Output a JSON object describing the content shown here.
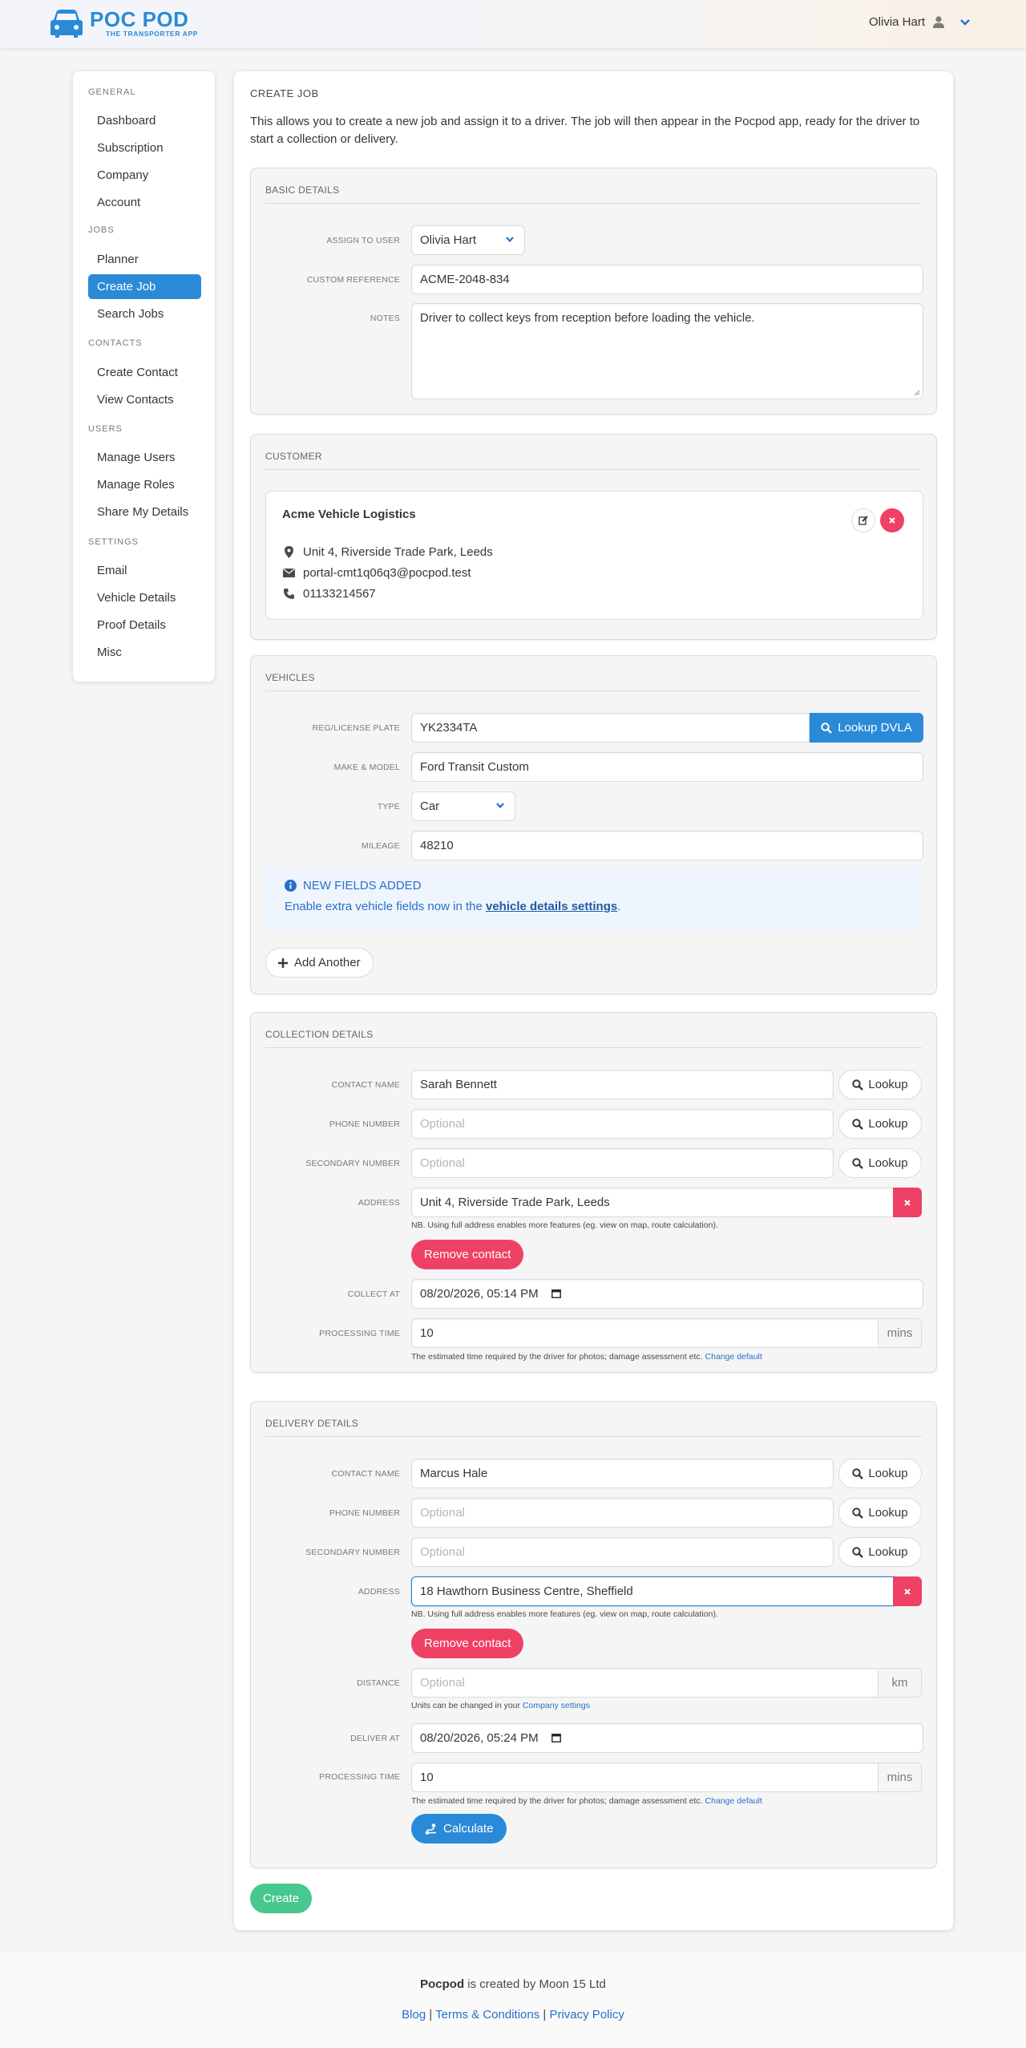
{
  "app": {
    "name": "POC POD",
    "tagline": "THE TRANSPORTER APP",
    "brand_color": "#2a8ad8",
    "user_name": "Olivia Hart"
  },
  "sidebar": {
    "sections": [
      {
        "title": "GENERAL",
        "items": [
          "Dashboard",
          "Subscription",
          "Company",
          "Account"
        ]
      },
      {
        "title": "JOBS",
        "items": [
          "Planner",
          "Create Job",
          "Search Jobs"
        ]
      },
      {
        "title": "CONTACTS",
        "items": [
          "Create Contact",
          "View Contacts"
        ]
      },
      {
        "title": "USERS",
        "items": [
          "Manage Users",
          "Manage Roles",
          "Share My Details"
        ]
      },
      {
        "title": "SETTINGS",
        "items": [
          "Email",
          "Vehicle Details",
          "Proof Details",
          "Misc"
        ]
      }
    ],
    "active_item": "Create Job"
  },
  "page": {
    "title": "CREATE JOB",
    "intro": "This allows you to create a new job and assign it to a driver. The job will then appear in the Pocpod app, ready for the driver to start a collection or delivery."
  },
  "basic": {
    "title": "BASIC DETAILS",
    "assign_label": "ASSIGN TO USER",
    "assign_value": "Olivia Hart",
    "ref_label": "CUSTOM REFERENCE",
    "ref_value": "ACME-2048-834",
    "notes_label": "NOTES",
    "notes_value": "Driver to collect keys from reception before loading the vehicle."
  },
  "customer": {
    "title": "CUSTOMER",
    "name": "Acme Vehicle Logistics",
    "address": "Unit 4, Riverside Trade Park, Leeds",
    "email": "portal-cmt1q06q3@pocpod.test",
    "phone": "01133214567"
  },
  "vehicles": {
    "title": "VEHICLES",
    "reg_label": "REG/LICENSE PLATE",
    "reg_value": "YK2334TA",
    "lookup_dvla": "Lookup DVLA",
    "make_label": "MAKE & MODEL",
    "make_value": "Ford Transit Custom",
    "type_label": "TYPE",
    "type_value": "Car",
    "mileage_label": "MILEAGE",
    "mileage_value": "48210",
    "notice_title": "NEW FIELDS ADDED",
    "notice_text": "Enable extra vehicle fields now in the ",
    "notice_link": "vehicle details settings",
    "notice_end": ".",
    "add_another": "Add Another"
  },
  "common": {
    "contact_name_label": "CONTACT NAME",
    "phone_label": "PHONE NUMBER",
    "secondary_label": "SECONDARY NUMBER",
    "address_label": "ADDRESS",
    "lookup": "Lookup",
    "optional": "Optional",
    "address_help": "NB. Using full address enables more features (eg. view on map, route calculation).",
    "remove_contact": "Remove contact",
    "processing_label": "PROCESSING TIME",
    "mins": "mins",
    "processing_help": "The estimated time required by the driver for photos; damage assessment etc.",
    "change_default": "Change default"
  },
  "collection": {
    "title": "COLLECTION DETAILS",
    "contact_name": "Sarah Bennett",
    "address": "Unit 4, Riverside Trade Park, Leeds",
    "at_label": "COLLECT AT",
    "at_value": "08/20/2026, 05:14 PM",
    "processing_value": "10"
  },
  "delivery": {
    "title": "DELIVERY DETAILS",
    "contact_name": "Marcus Hale",
    "address": "18 Hawthorn Business Centre, Sheffield",
    "distance_label": "DISTANCE",
    "distance_unit": "km",
    "units_help": "Units can be changed in your ",
    "units_link": "Company settings",
    "at_label": "DELIVER AT",
    "at_value": "08/20/2026, 05:24 PM",
    "processing_value": "10",
    "calculate": "Calculate"
  },
  "create_button": "Create",
  "footer": {
    "brand": "Pocpod",
    "created_by": " is created by Moon 15 Ltd",
    "links": [
      "Blog",
      "Terms & Conditions",
      "Privacy Policy"
    ],
    "separator": " | "
  }
}
